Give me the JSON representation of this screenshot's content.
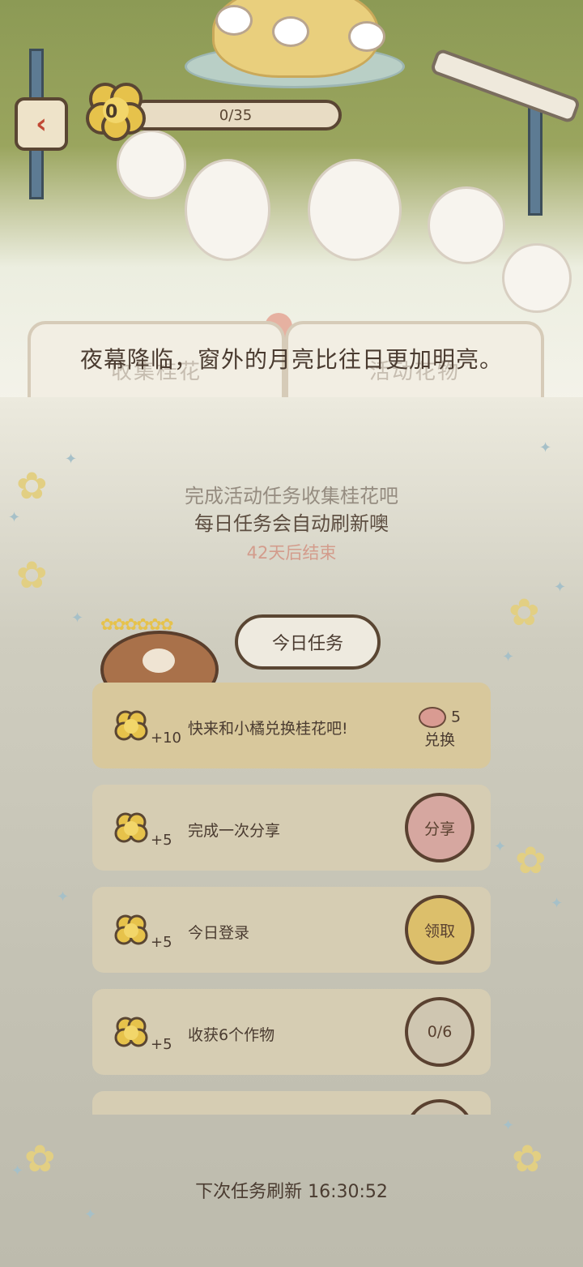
{
  "header": {
    "back_icon": "chevron-left-icon",
    "flower_count": "0",
    "progress_text": "0/35",
    "progress_fraction": 0.0
  },
  "tabs": [
    {
      "label": "收集桂花"
    },
    {
      "label": "活动花物"
    }
  ],
  "narration": "夜幕降临，窗外的月亮比往日更加明亮。",
  "intro": {
    "line1": "完成活动任务收集桂花吧",
    "line2": "每日任务会自动刷新噢",
    "ends_in": "42天后结束"
  },
  "today_tasks_label": "今日任务",
  "tasks": [
    {
      "reward": "+10",
      "label": "快来和小橘兑换桂花吧!",
      "cost": "5",
      "action": "兑换"
    },
    {
      "reward": "+5",
      "label": "完成一次分享",
      "action": "分享"
    },
    {
      "reward": "+5",
      "label": "今日登录",
      "action": "领取"
    },
    {
      "reward": "+5",
      "label": "收获6个作物",
      "action": "0/6"
    }
  ],
  "footer": {
    "refresh_text": "下次任务刷新 16:30:52"
  },
  "colors": {
    "accent_gold": "#dcbf6b",
    "share_pink": "#d6a7a0",
    "outline_brown": "#5a4633"
  }
}
